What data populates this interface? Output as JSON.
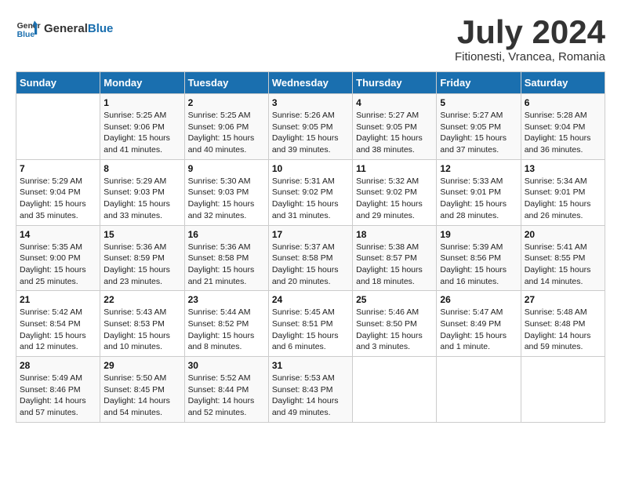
{
  "header": {
    "logo": "GeneralBlue",
    "month": "July 2024",
    "location": "Fitionesti, Vrancea, Romania"
  },
  "days_of_week": [
    "Sunday",
    "Monday",
    "Tuesday",
    "Wednesday",
    "Thursday",
    "Friday",
    "Saturday"
  ],
  "weeks": [
    [
      {
        "day": "",
        "info": ""
      },
      {
        "day": "1",
        "info": "Sunrise: 5:25 AM\nSunset: 9:06 PM\nDaylight: 15 hours\nand 41 minutes."
      },
      {
        "day": "2",
        "info": "Sunrise: 5:25 AM\nSunset: 9:06 PM\nDaylight: 15 hours\nand 40 minutes."
      },
      {
        "day": "3",
        "info": "Sunrise: 5:26 AM\nSunset: 9:05 PM\nDaylight: 15 hours\nand 39 minutes."
      },
      {
        "day": "4",
        "info": "Sunrise: 5:27 AM\nSunset: 9:05 PM\nDaylight: 15 hours\nand 38 minutes."
      },
      {
        "day": "5",
        "info": "Sunrise: 5:27 AM\nSunset: 9:05 PM\nDaylight: 15 hours\nand 37 minutes."
      },
      {
        "day": "6",
        "info": "Sunrise: 5:28 AM\nSunset: 9:04 PM\nDaylight: 15 hours\nand 36 minutes."
      }
    ],
    [
      {
        "day": "7",
        "info": "Sunrise: 5:29 AM\nSunset: 9:04 PM\nDaylight: 15 hours\nand 35 minutes."
      },
      {
        "day": "8",
        "info": "Sunrise: 5:29 AM\nSunset: 9:03 PM\nDaylight: 15 hours\nand 33 minutes."
      },
      {
        "day": "9",
        "info": "Sunrise: 5:30 AM\nSunset: 9:03 PM\nDaylight: 15 hours\nand 32 minutes."
      },
      {
        "day": "10",
        "info": "Sunrise: 5:31 AM\nSunset: 9:02 PM\nDaylight: 15 hours\nand 31 minutes."
      },
      {
        "day": "11",
        "info": "Sunrise: 5:32 AM\nSunset: 9:02 PM\nDaylight: 15 hours\nand 29 minutes."
      },
      {
        "day": "12",
        "info": "Sunrise: 5:33 AM\nSunset: 9:01 PM\nDaylight: 15 hours\nand 28 minutes."
      },
      {
        "day": "13",
        "info": "Sunrise: 5:34 AM\nSunset: 9:01 PM\nDaylight: 15 hours\nand 26 minutes."
      }
    ],
    [
      {
        "day": "14",
        "info": "Sunrise: 5:35 AM\nSunset: 9:00 PM\nDaylight: 15 hours\nand 25 minutes."
      },
      {
        "day": "15",
        "info": "Sunrise: 5:36 AM\nSunset: 8:59 PM\nDaylight: 15 hours\nand 23 minutes."
      },
      {
        "day": "16",
        "info": "Sunrise: 5:36 AM\nSunset: 8:58 PM\nDaylight: 15 hours\nand 21 minutes."
      },
      {
        "day": "17",
        "info": "Sunrise: 5:37 AM\nSunset: 8:58 PM\nDaylight: 15 hours\nand 20 minutes."
      },
      {
        "day": "18",
        "info": "Sunrise: 5:38 AM\nSunset: 8:57 PM\nDaylight: 15 hours\nand 18 minutes."
      },
      {
        "day": "19",
        "info": "Sunrise: 5:39 AM\nSunset: 8:56 PM\nDaylight: 15 hours\nand 16 minutes."
      },
      {
        "day": "20",
        "info": "Sunrise: 5:41 AM\nSunset: 8:55 PM\nDaylight: 15 hours\nand 14 minutes."
      }
    ],
    [
      {
        "day": "21",
        "info": "Sunrise: 5:42 AM\nSunset: 8:54 PM\nDaylight: 15 hours\nand 12 minutes."
      },
      {
        "day": "22",
        "info": "Sunrise: 5:43 AM\nSunset: 8:53 PM\nDaylight: 15 hours\nand 10 minutes."
      },
      {
        "day": "23",
        "info": "Sunrise: 5:44 AM\nSunset: 8:52 PM\nDaylight: 15 hours\nand 8 minutes."
      },
      {
        "day": "24",
        "info": "Sunrise: 5:45 AM\nSunset: 8:51 PM\nDaylight: 15 hours\nand 6 minutes."
      },
      {
        "day": "25",
        "info": "Sunrise: 5:46 AM\nSunset: 8:50 PM\nDaylight: 15 hours\nand 3 minutes."
      },
      {
        "day": "26",
        "info": "Sunrise: 5:47 AM\nSunset: 8:49 PM\nDaylight: 15 hours\nand 1 minute."
      },
      {
        "day": "27",
        "info": "Sunrise: 5:48 AM\nSunset: 8:48 PM\nDaylight: 14 hours\nand 59 minutes."
      }
    ],
    [
      {
        "day": "28",
        "info": "Sunrise: 5:49 AM\nSunset: 8:46 PM\nDaylight: 14 hours\nand 57 minutes."
      },
      {
        "day": "29",
        "info": "Sunrise: 5:50 AM\nSunset: 8:45 PM\nDaylight: 14 hours\nand 54 minutes."
      },
      {
        "day": "30",
        "info": "Sunrise: 5:52 AM\nSunset: 8:44 PM\nDaylight: 14 hours\nand 52 minutes."
      },
      {
        "day": "31",
        "info": "Sunrise: 5:53 AM\nSunset: 8:43 PM\nDaylight: 14 hours\nand 49 minutes."
      },
      {
        "day": "",
        "info": ""
      },
      {
        "day": "",
        "info": ""
      },
      {
        "day": "",
        "info": ""
      }
    ]
  ]
}
